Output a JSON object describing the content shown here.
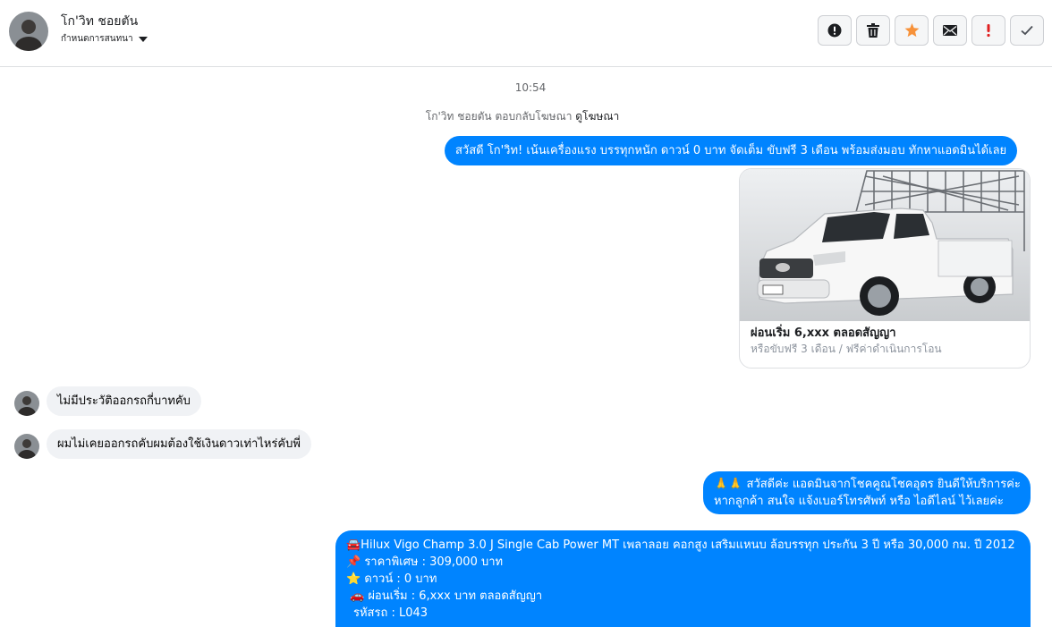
{
  "header": {
    "contact_name": "โก'วิท ชอยตัน",
    "assign_label": "กำหนดการสนทนา"
  },
  "toolbar": [
    {
      "name": "report-button",
      "icon": "alert-circle-icon"
    },
    {
      "name": "delete-button",
      "icon": "trash-icon"
    },
    {
      "name": "star-button",
      "icon": "star-icon"
    },
    {
      "name": "mark-unread-button",
      "icon": "envelope-icon"
    },
    {
      "name": "important-button",
      "icon": "exclamation-icon"
    },
    {
      "name": "done-button",
      "icon": "check-icon"
    }
  ],
  "colors": {
    "accent": "#0084ff",
    "star": "#f7923a",
    "important": "#e02020"
  },
  "conversation": {
    "timestamp": "10:54",
    "system_text": "โก'วิท ชอยตัน ตอบกลับโฆษณา",
    "system_link": "ดูโฆษณา",
    "messages": [
      {
        "dir": "out",
        "text": "สวัสดี โก'วิท! เน้นเครื่องแรง บรรทุกหนัก ดาวน์ 0 บาท จัดเต็ม ขับฟรี 3 เดือน พร้อมส่งมอบ ทักหาแอดมินได้เลย"
      },
      {
        "dir": "in",
        "text": "ไม่มีประวัติออกรถกี่บาทคับ"
      },
      {
        "dir": "in",
        "text": "ผมไม่เคยออกรถคับผมต้องใช้เงินดาวเท่าไหร่คับพี่"
      },
      {
        "dir": "out",
        "lines": [
          "🙏🙏 สวัสดีค่ะ แอดมินจากโชคคูณโชคอุดร ยินดีให้บริการค่ะ",
          "หากลูกค้า สนใจ แจ้งเบอร์โทรศัพท์ หรือ ไอดีไลน์  ไว้เลยค่ะ"
        ]
      },
      {
        "dir": "out",
        "lines": [
          "🚘Hilux Vigo Champ 3.0 J Single Cab Power MT เพลาลอย คอกสูง เสริมแหนบ ล้อบรรทุก ประกัน 3 ปี หรือ 30,000 กม. ปี 2012",
          "📌 ราคาพิเศษ : 309,000 บาท",
          "⭐ ดาวน์ : 0 บาท",
          "🚗 ผ่อนเริ่ม : 6,xxx บาท ตลอดสัญญา",
          "รหัสรถ : L043"
        ]
      }
    ],
    "ad_card": {
      "title": "ผ่อนเริ่ม 6,xxx ตลอดสัญญา",
      "subtitle": "หรือขับฟรี 3 เดือน / ฟรีค่าดำเนินการโอน"
    }
  }
}
